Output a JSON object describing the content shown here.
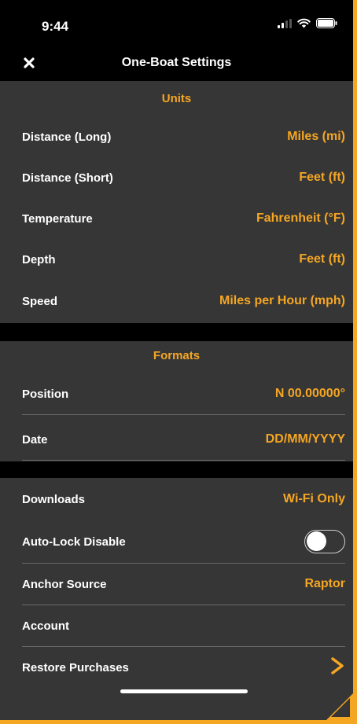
{
  "status_bar": {
    "time": "9:44"
  },
  "nav": {
    "title": "One-Boat Settings",
    "close_icon": "close-icon"
  },
  "units": {
    "header": "Units",
    "rows": [
      {
        "label": "Distance (Long)",
        "value": "Miles (mi)"
      },
      {
        "label": "Distance (Short)",
        "value": "Feet (ft)"
      },
      {
        "label": "Temperature",
        "value": "Fahrenheit (°F)"
      },
      {
        "label": "Depth",
        "value": "Feet (ft)"
      },
      {
        "label": "Speed",
        "value": "Miles per Hour (mph)"
      }
    ]
  },
  "formats": {
    "header": "Formats",
    "rows": [
      {
        "label": "Position",
        "value": "N 00.00000°"
      },
      {
        "label": "Date",
        "value": "DD/MM/YYYY"
      }
    ]
  },
  "general": {
    "downloads": {
      "label": "Downloads",
      "value": "Wi-Fi Only"
    },
    "auto_lock": {
      "label": "Auto-Lock Disable",
      "enabled": false
    },
    "anchor_source": {
      "label": "Anchor Source",
      "value": "Raptor"
    },
    "account": {
      "label": "Account"
    },
    "restore_purchases": {
      "label": "Restore Purchases",
      "icon": "chevron-right-icon"
    }
  },
  "colors": {
    "accent": "#f5a623",
    "background": "#363636",
    "bar": "#000000"
  }
}
